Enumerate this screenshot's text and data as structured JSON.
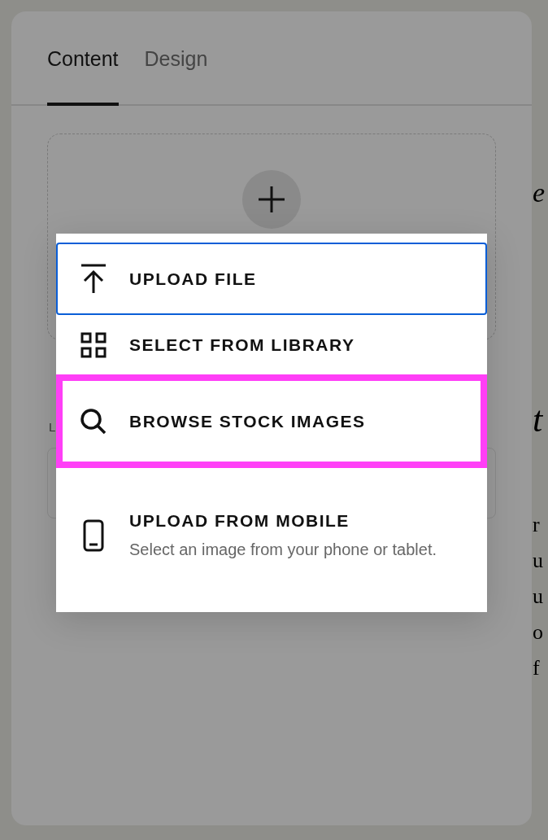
{
  "tabs": [
    {
      "label": "Content",
      "selected": true
    },
    {
      "label": "Design",
      "selected": false
    }
  ],
  "image_field": {
    "label": "L"
  },
  "upload_menu": {
    "items": [
      {
        "label": "UPLOAD FILE",
        "focused": true,
        "highlighted": false
      },
      {
        "label": "SELECT FROM LIBRARY",
        "focused": false,
        "highlighted": false
      },
      {
        "label": "BROWSE STOCK IMAGES",
        "focused": false,
        "highlighted": true
      },
      {
        "label": "UPLOAD FROM MOBILE",
        "description": "Select an image from your phone or tablet.",
        "focused": false,
        "highlighted": false
      }
    ]
  },
  "page_preview": {
    "headings": [
      "e",
      "t"
    ],
    "lines": [
      "r",
      "u",
      "u",
      "o",
      "f"
    ]
  }
}
